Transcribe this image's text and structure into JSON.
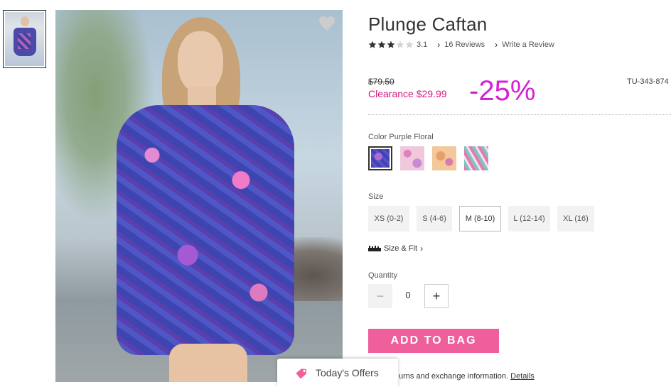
{
  "product": {
    "title": "Plunge Caftan",
    "rating_value": "3.1",
    "rating_stars": 3.1,
    "reviews_link": "16 Reviews",
    "write_review_link": "Write a Review",
    "price_original": "$79.50",
    "price_clearance": "Clearance $29.99",
    "discount": "-25%",
    "sku": "TU-343-874"
  },
  "color": {
    "label": "Color",
    "selected_name": "Purple Floral",
    "swatches": [
      {
        "name": "Purple Floral",
        "selected": true
      },
      {
        "name": "Pink Paisley",
        "selected": false
      },
      {
        "name": "Orange Paisley",
        "selected": false
      },
      {
        "name": "Pink Ikat",
        "selected": false
      }
    ]
  },
  "size": {
    "label": "Size",
    "options": [
      "XS (0-2)",
      "S (4-6)",
      "M (8-10)",
      "L (12-14)",
      "XL (16)"
    ],
    "selected": "M (8-10)",
    "fit_link": "Size & Fit"
  },
  "quantity": {
    "label": "Quantity",
    "minus": "−",
    "value": "0",
    "plus": "+"
  },
  "actions": {
    "add_to_bag": "ADD TO BAG"
  },
  "returns": {
    "text": "urns and exchange information.",
    "details_link": "Details"
  },
  "offers": {
    "label": "Today's Offers"
  },
  "icons": {
    "favorite": "heart-icon",
    "star": "star-icon",
    "chevron": "chevron-right-icon",
    "ruler": "ruler-icon",
    "tag": "tag-icon"
  },
  "colors": {
    "clearance": "#d4197d",
    "discount": "#d61fd6",
    "add_to_bag_bg": "#ee5f9c"
  }
}
